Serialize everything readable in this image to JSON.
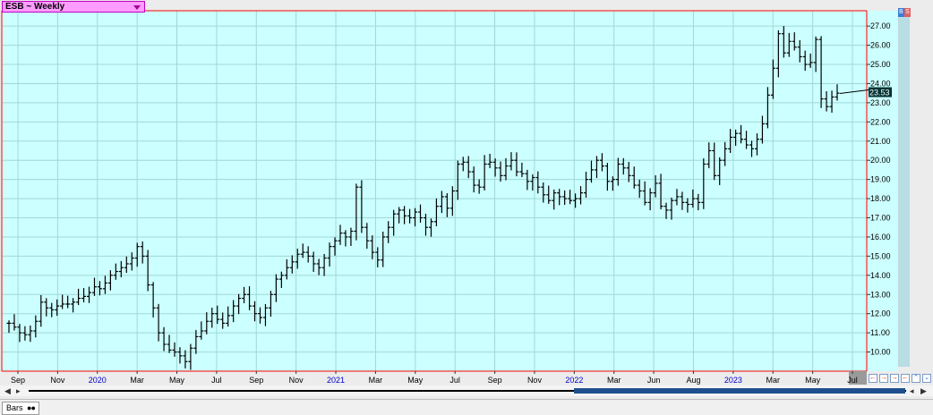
{
  "window": {
    "symbol_label": "ESB ~ Weekly",
    "last_price_label": "23.53",
    "tab_label": "Bars",
    "corner_buttons": [
      "B",
      "S"
    ],
    "nav_buttons": [
      "left-icon",
      "right-icon",
      "zoom-in-icon",
      "zoom-out-icon",
      "up-icon",
      "down-icon"
    ]
  },
  "colors": {
    "plot_bg": "#ccffff",
    "grid": "#9fd8d8",
    "axis": "#ff0000",
    "bars": "#000000",
    "price_tag": "#003333",
    "year_label": "#0000cc",
    "scrollbar_thumb": "#1f4f8f",
    "symbol_box": "#ff9cff"
  },
  "chart_data": {
    "type": "bar",
    "subtype": "ohlc",
    "interval": "Weekly",
    "x_ticks": [
      {
        "label": "Sep",
        "year": false
      },
      {
        "label": "Nov",
        "year": false
      },
      {
        "label": "2020",
        "year": true
      },
      {
        "label": "Mar",
        "year": false
      },
      {
        "label": "May",
        "year": false
      },
      {
        "label": "Jul",
        "year": false
      },
      {
        "label": "Sep",
        "year": false
      },
      {
        "label": "Nov",
        "year": false
      },
      {
        "label": "2021",
        "year": true
      },
      {
        "label": "Mar",
        "year": false
      },
      {
        "label": "May",
        "year": false
      },
      {
        "label": "Jul",
        "year": false
      },
      {
        "label": "Sep",
        "year": false
      },
      {
        "label": "Nov",
        "year": false
      },
      {
        "label": "2022",
        "year": true
      },
      {
        "label": "Mar",
        "year": false
      },
      {
        "label": "Jun",
        "year": false
      },
      {
        "label": "Aug",
        "year": false
      },
      {
        "label": "2023",
        "year": true
      },
      {
        "label": "Mar",
        "year": false
      },
      {
        "label": "May",
        "year": false
      },
      {
        "label": "Jul",
        "year": false
      }
    ],
    "y_ticks": [
      "27.00",
      "26.00",
      "25.00",
      "24.00",
      "23.00",
      "22.00",
      "21.00",
      "20.00",
      "19.00",
      "18.00",
      "17.00",
      "16.00",
      "15.00",
      "14.00",
      "13.00",
      "12.00",
      "11.00",
      "10.00"
    ],
    "ylim": [
      9.0,
      27.8
    ],
    "grid": true,
    "last_price": 23.53,
    "closes": [
      11.5,
      11.3,
      11.0,
      10.9,
      11.1,
      11.6,
      12.6,
      12.3,
      12.2,
      12.4,
      12.5,
      12.5,
      12.6,
      12.8,
      12.9,
      13.1,
      13.4,
      13.3,
      13.6,
      14.0,
      14.2,
      14.4,
      14.6,
      14.9,
      15.5,
      15.0,
      13.5,
      12.3,
      11.0,
      10.4,
      10.1,
      10.0,
      9.8,
      9.5,
      10.2,
      10.8,
      11.1,
      11.6,
      12.0,
      11.7,
      11.5,
      11.9,
      12.4,
      12.8,
      13.0,
      12.4,
      12.0,
      11.8,
      12.3,
      13.0,
      13.8,
      14.0,
      14.4,
      14.7,
      15.1,
      15.2,
      15.0,
      14.6,
      14.4,
      14.9,
      15.5,
      15.8,
      16.2,
      16.0,
      16.3,
      18.6,
      16.5,
      15.8,
      15.2,
      14.8,
      16.0,
      16.5,
      17.2,
      17.4,
      17.1,
      17.0,
      17.3,
      17.0,
      16.5,
      16.8,
      17.6,
      18.1,
      17.5,
      18.4,
      19.8,
      19.9,
      19.4,
      18.7,
      18.6,
      19.8,
      19.9,
      19.6,
      19.2,
      19.7,
      20.0,
      19.4,
      19.3,
      18.9,
      19.1,
      18.6,
      18.2,
      17.9,
      18.3,
      18.1,
      18.0,
      17.9,
      18.0,
      18.3,
      19.0,
      19.5,
      20.0,
      19.7,
      18.9,
      19.0,
      19.8,
      19.6,
      19.2,
      18.7,
      18.4,
      17.8,
      18.3,
      18.8,
      17.6,
      17.4,
      17.9,
      18.1,
      17.8,
      17.7,
      18.0,
      17.8,
      19.8,
      20.5,
      19.2,
      20.0,
      20.6,
      21.2,
      21.4,
      21.1,
      20.8,
      20.6,
      21.1,
      21.9,
      23.4,
      24.8,
      26.6,
      25.6,
      26.2,
      25.9,
      25.4,
      25.0,
      25.1,
      26.3,
      23.2,
      22.8,
      23.3,
      23.5
    ]
  }
}
